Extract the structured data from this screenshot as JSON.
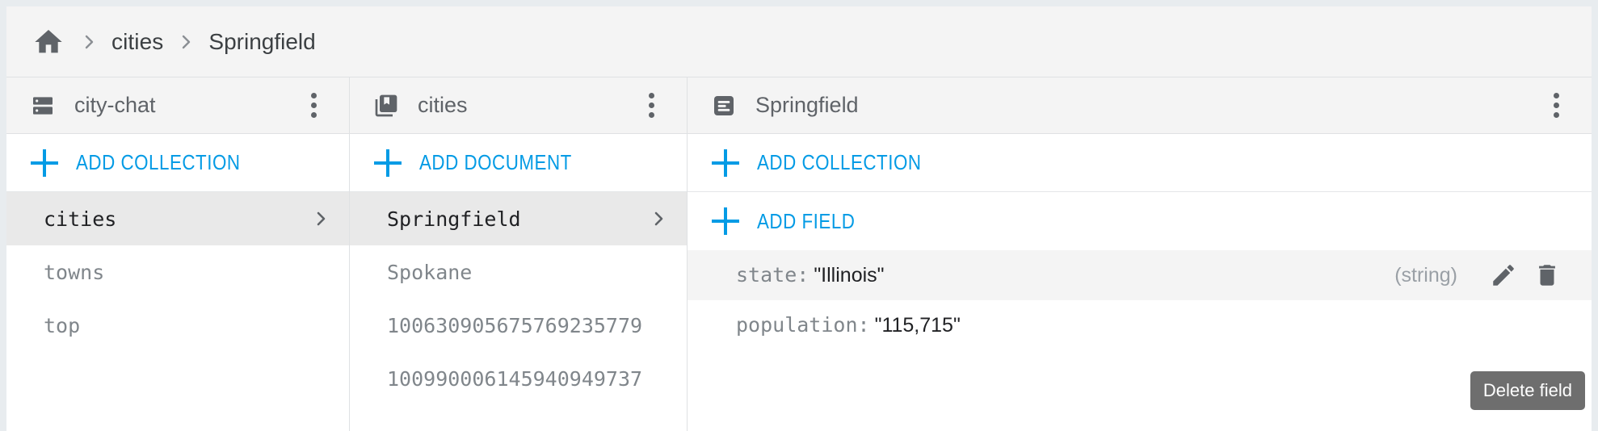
{
  "theme": {
    "accent": "#039be5",
    "page_bg": "#e8ecef",
    "panel_bg": "#ffffff",
    "header_bg": "#f4f4f4",
    "selected_bg": "#e9e9e9",
    "text_primary": "#202124",
    "text_secondary": "#5f6368",
    "text_muted": "#80868b",
    "tooltip_bg": "#6e6e6e"
  },
  "breadcrumb": {
    "home_icon": "home-icon",
    "separator_icon": "chevron-right-icon",
    "items": [
      {
        "label": "cities",
        "current": false
      },
      {
        "label": "Springfield",
        "current": true
      }
    ]
  },
  "panels": {
    "database": {
      "icon": "database-icon",
      "title": "city-chat",
      "menu_icon": "more-vert-icon",
      "add_label": "ADD COLLECTION",
      "add_icon": "plus-icon",
      "items": [
        {
          "label": "cities",
          "selected": true,
          "chevron": "chevron-right-icon"
        },
        {
          "label": "towns",
          "selected": false,
          "chevron": ""
        },
        {
          "label": "top",
          "selected": false,
          "chevron": ""
        }
      ]
    },
    "collection": {
      "icon": "collections-bookmark-icon",
      "title": "cities",
      "menu_icon": "more-vert-icon",
      "add_label": "ADD DOCUMENT",
      "add_icon": "plus-icon",
      "items": [
        {
          "label": "Springfield",
          "selected": true,
          "chevron": "chevron-right-icon"
        },
        {
          "label": "Spokane",
          "selected": false,
          "chevron": ""
        },
        {
          "label": "100630905675769235779",
          "selected": false,
          "chevron": ""
        },
        {
          "label": "100990006145940949737",
          "selected": false,
          "chevron": ""
        }
      ]
    },
    "document": {
      "icon": "document-icon",
      "title": "Springfield",
      "menu_icon": "more-vert-icon",
      "add_collection_label": "ADD COLLECTION",
      "add_field_label": "ADD FIELD",
      "add_icon": "plus-icon",
      "fields": [
        {
          "key": "state:",
          "value": "\"Illinois\"",
          "type": "(string)",
          "hovered": true,
          "edit_icon": "pencil-icon",
          "delete_icon": "trash-icon"
        },
        {
          "key": "population:",
          "value": "\"115,715\"",
          "type": "",
          "hovered": false,
          "edit_icon": "pencil-icon",
          "delete_icon": "trash-icon"
        }
      ]
    }
  },
  "tooltip": {
    "label": "Delete field"
  }
}
